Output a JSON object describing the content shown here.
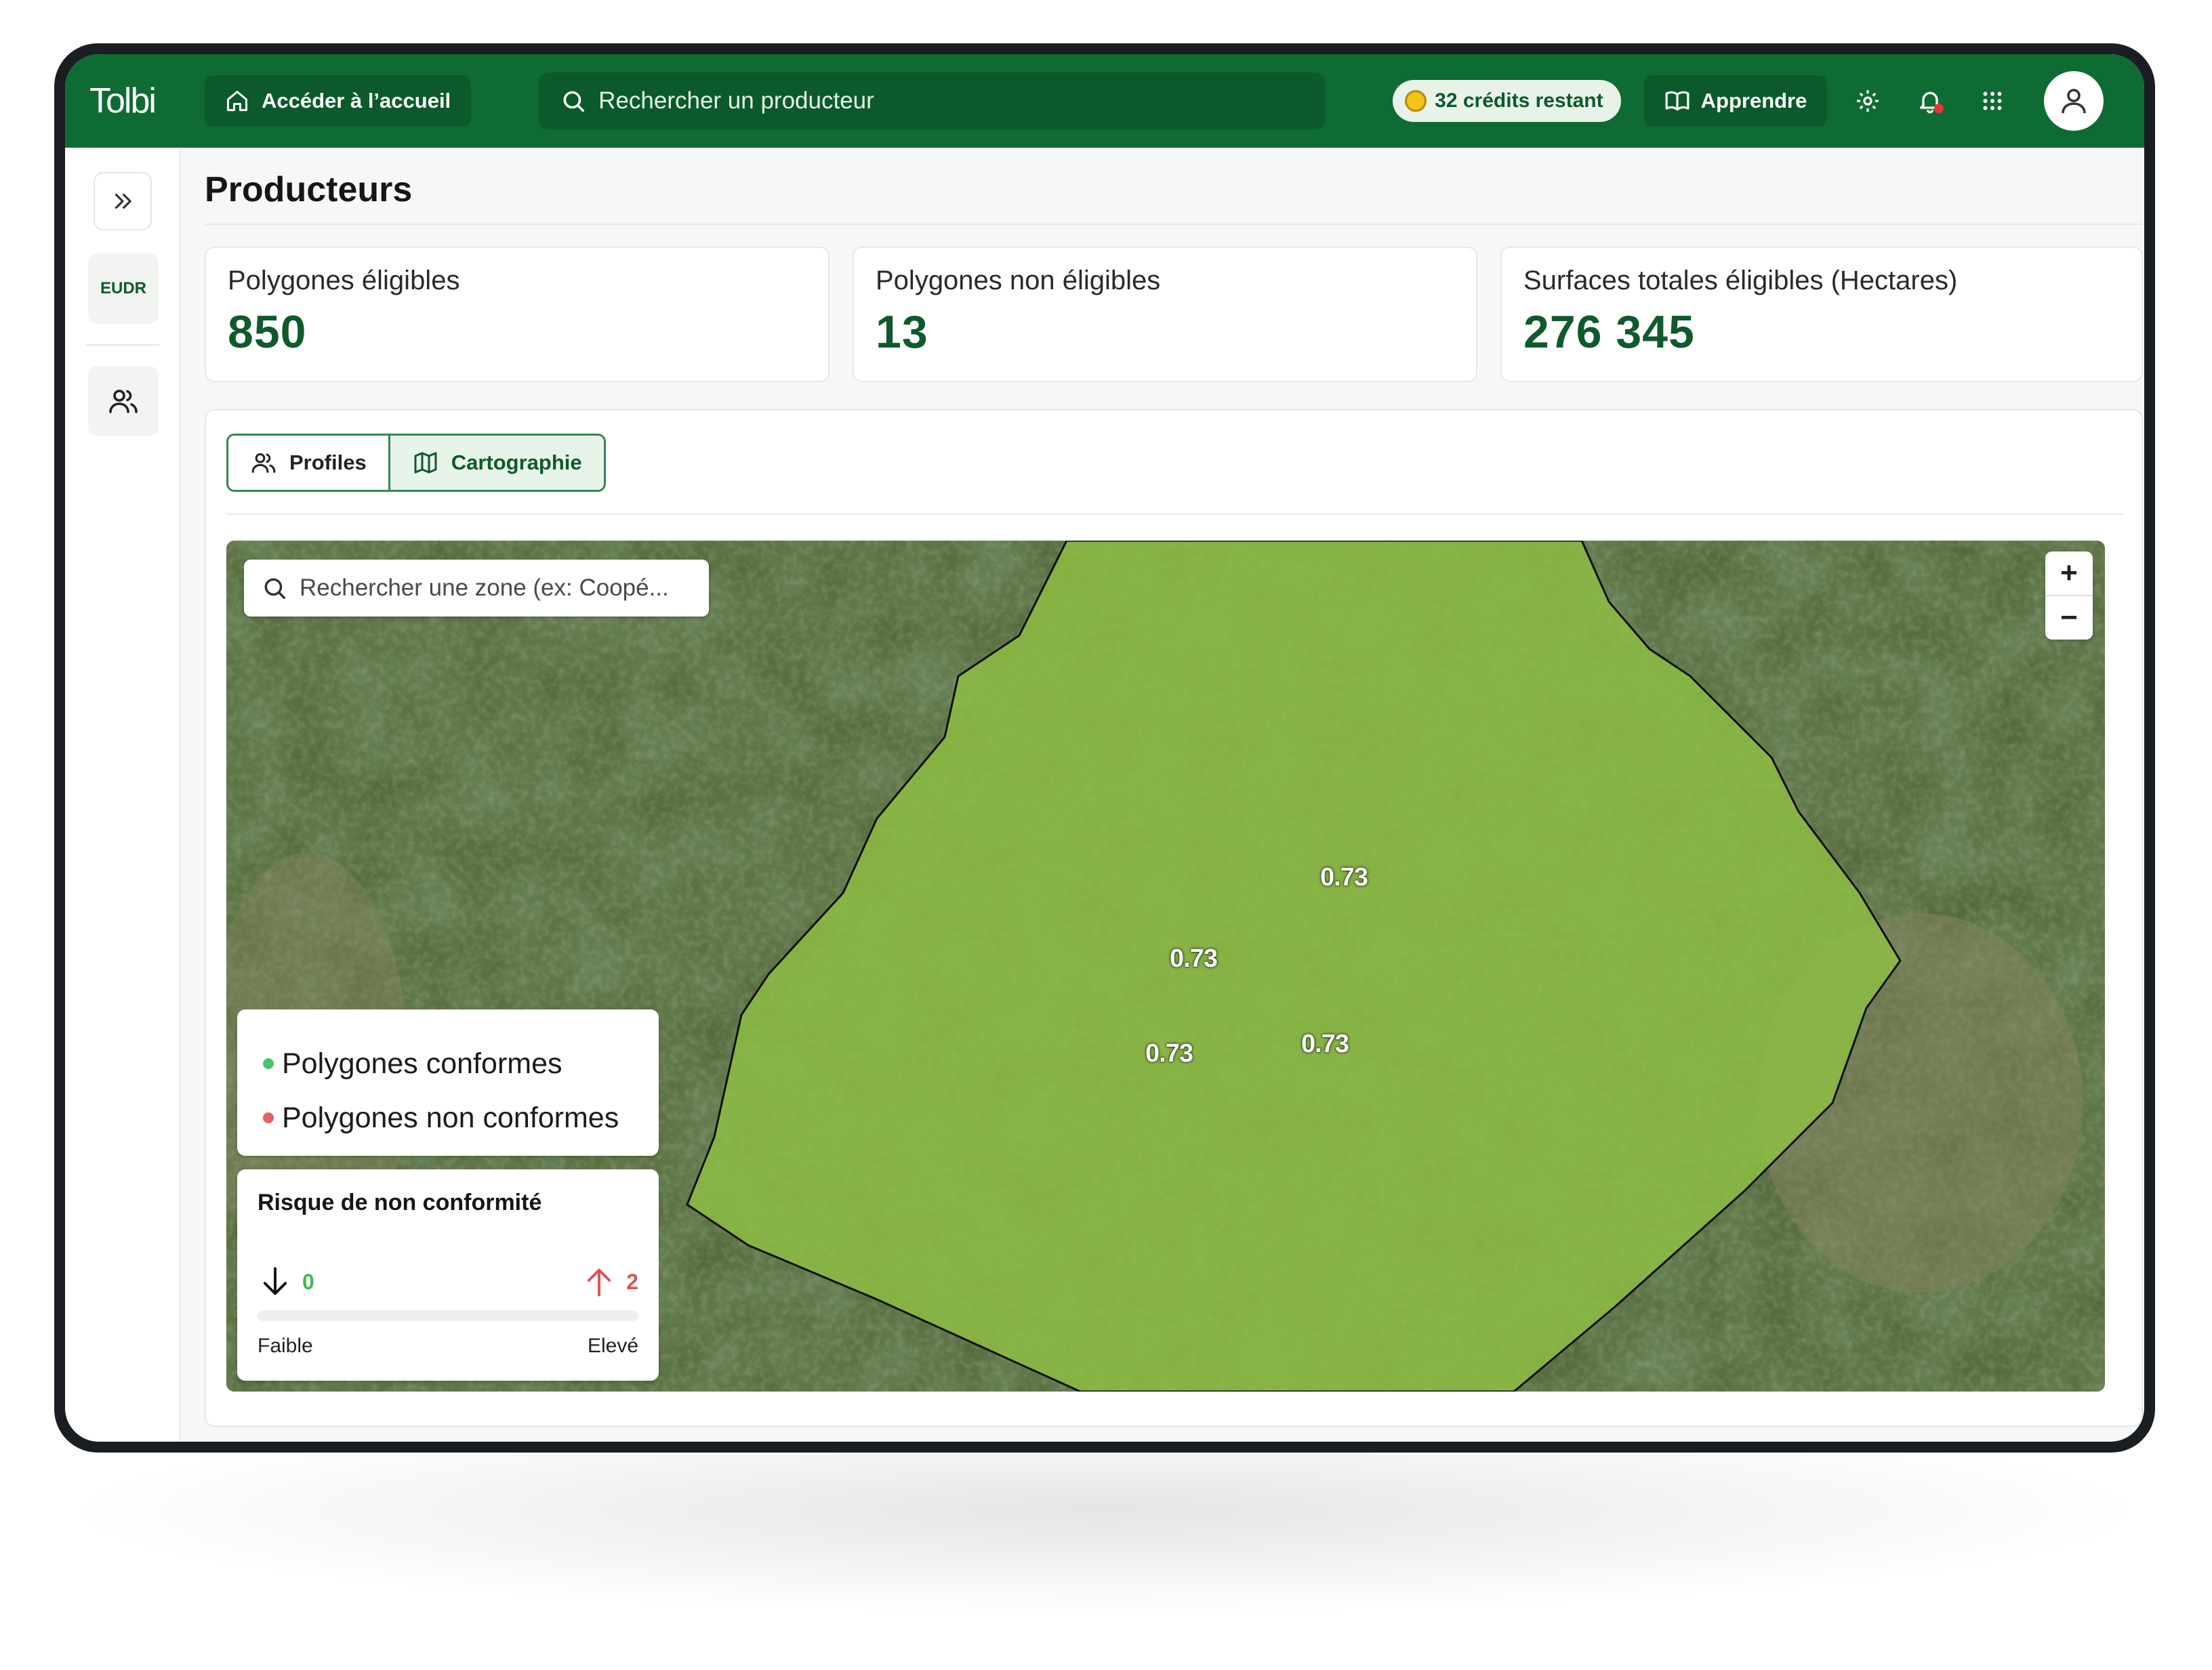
{
  "app": {
    "logo": "Tolbi"
  },
  "topbar": {
    "home_label": "Accéder à l’accueil",
    "search_placeholder": "Rechercher un producteur",
    "credits_label": "32 crédits restant",
    "learn_label": "Apprendre"
  },
  "sidebar": {
    "eudr_label": "EUDR"
  },
  "page": {
    "title": "Producteurs"
  },
  "stats": [
    {
      "label": "Polygones éligibles",
      "value": "850"
    },
    {
      "label": "Polygones non éligibles",
      "value": "13"
    },
    {
      "label": "Surfaces totales éligibles (Hectares)",
      "value": "276 345"
    }
  ],
  "tabs": [
    {
      "label": "Profiles",
      "active": false
    },
    {
      "label": "Cartographie",
      "active": true
    }
  ],
  "map": {
    "search_placeholder": "Rechercher une zone (ex: Coopé...",
    "zoom_in": "+",
    "zoom_out": "−",
    "polygon_labels": [
      "0.73",
      "0.73",
      "0.73",
      "0.73"
    ],
    "legend": [
      {
        "label": "Polygones conformes",
        "color": "#4cc46a"
      },
      {
        "label": "Polygones non conformes",
        "color": "#e46262"
      }
    ],
    "risk": {
      "title": "Risque de non conformité",
      "low_value": "0",
      "high_value": "2",
      "low_label": "Faible",
      "high_label": "Elevé"
    }
  },
  "colors": {
    "brand_green": "#0f6b34",
    "accent_dark": "#0f5a2c",
    "polygon_fill": "#8fc043"
  }
}
